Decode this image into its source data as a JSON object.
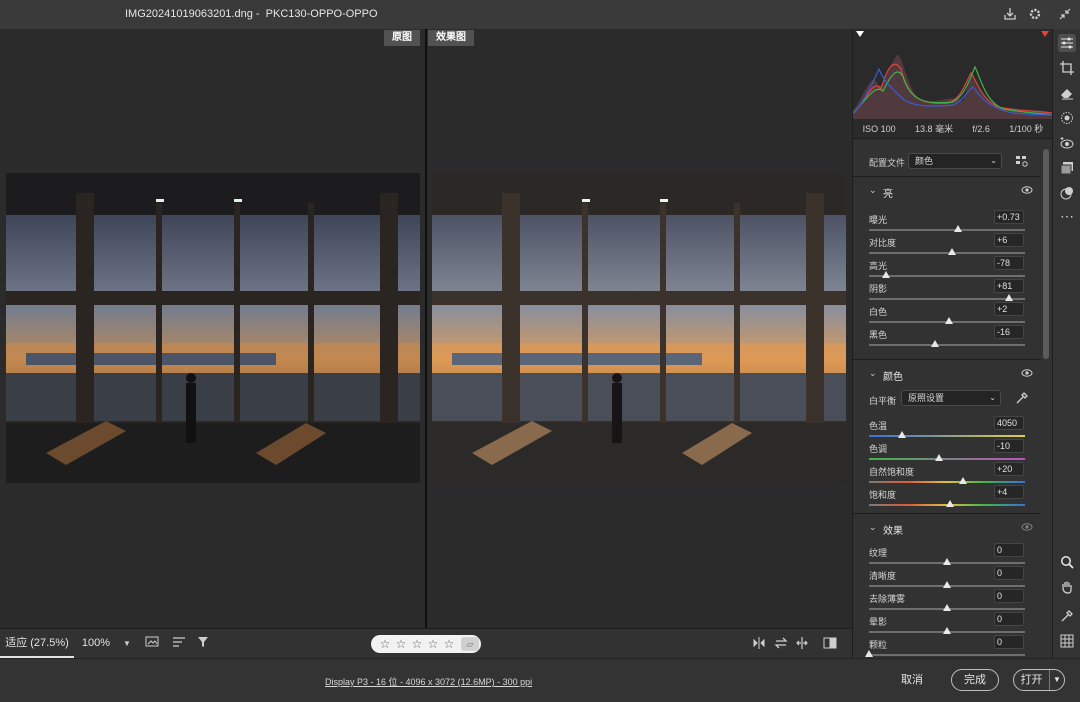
{
  "window": {
    "title": "IMG20241019063201.dng -  PKC130-OPPO-OPPO"
  },
  "canvas": {
    "before_label": "原图",
    "after_label": "效果图"
  },
  "bottom_toolbar": {
    "fit_label": "适应 (27.5%)",
    "zoom_label": "100%",
    "stars": [
      "☆",
      "☆",
      "☆",
      "☆",
      "☆"
    ],
    "trash_icon": "trash-icon"
  },
  "status": {
    "info_link": "Display P3 - 16 位 - 4096 x 3072 (12.6MP) - 300 ppi",
    "cancel": "取消",
    "done": "完成",
    "open": "打开"
  },
  "exif": {
    "iso": "ISO 100",
    "focal": "13.8 毫米",
    "aperture": "f/2.6",
    "shutter": "1/100 秒"
  },
  "profile": {
    "label": "配置文件",
    "value": "颜色"
  },
  "sections": {
    "light": {
      "title": "亮",
      "sliders": [
        {
          "label": "曝光",
          "value": "+0.73",
          "pos": 0.57
        },
        {
          "label": "对比度",
          "value": "+6",
          "pos": 0.53
        },
        {
          "label": "高光",
          "value": "-78",
          "pos": 0.11
        },
        {
          "label": "阴影",
          "value": "+81",
          "pos": 0.9
        },
        {
          "label": "白色",
          "value": "+2",
          "pos": 0.51
        },
        {
          "label": "黑色",
          "value": "-16",
          "pos": 0.42
        }
      ]
    },
    "color": {
      "title": "颜色",
      "wb_label": "白平衡",
      "wb_value": "原照设置",
      "sliders": [
        {
          "label": "色温",
          "value": "4050",
          "pos": 0.21
        },
        {
          "label": "色调",
          "value": "-10",
          "pos": 0.45
        },
        {
          "label": "自然饱和度",
          "value": "+20",
          "pos": 0.6
        },
        {
          "label": "饱和度",
          "value": "+4",
          "pos": 0.52
        }
      ]
    },
    "effects": {
      "title": "效果",
      "sliders": [
        {
          "label": "纹理",
          "value": "0",
          "pos": 0.5
        },
        {
          "label": "清晰度",
          "value": "0",
          "pos": 0.5
        },
        {
          "label": "去除薄雾",
          "value": "0",
          "pos": 0.5
        },
        {
          "label": "晕影",
          "value": "0",
          "pos": 0.5
        },
        {
          "label": "颗粒",
          "value": "0",
          "pos": 0.0
        }
      ]
    }
  },
  "colors": {
    "accent": "#e8e8e8",
    "clip_warning": "#e8403a"
  }
}
